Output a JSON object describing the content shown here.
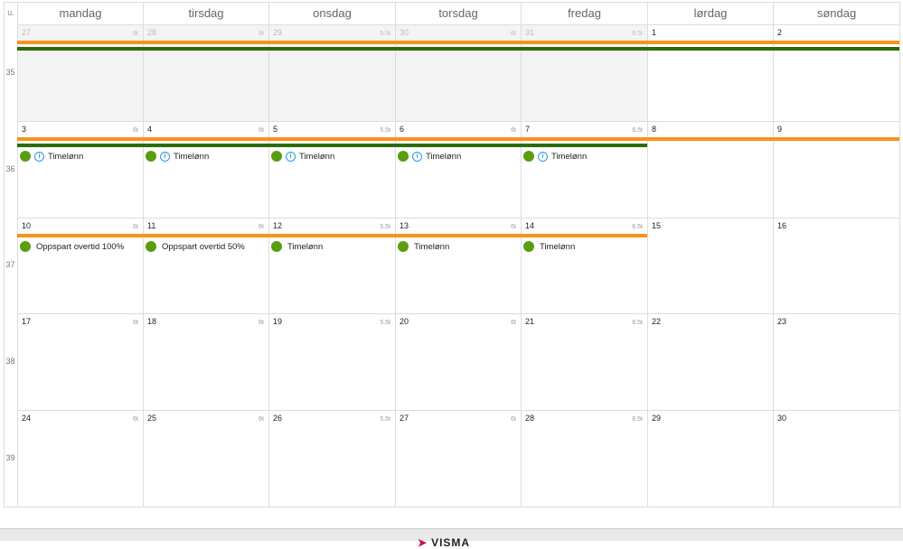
{
  "week_header": "u.",
  "days": [
    "mandag",
    "tirsdag",
    "onsdag",
    "torsdag",
    "fredag",
    "lørdag",
    "søndag"
  ],
  "weeks": [
    {
      "num": "35",
      "dates": [
        "27",
        "28",
        "29",
        "30",
        "31",
        "1",
        "2"
      ],
      "other": [
        true,
        true,
        true,
        true,
        true,
        false,
        false
      ],
      "hours": [
        "6t",
        "6t",
        "5.5t",
        "6t",
        "6.5t",
        "",
        ""
      ],
      "bars": [
        {
          "color": "#f7931e",
          "from": 0,
          "to": 7
        },
        {
          "color": "#2e6b0a",
          "from": 0,
          "to": 7
        }
      ],
      "events": []
    },
    {
      "num": "36",
      "dates": [
        "3",
        "4",
        "5",
        "6",
        "7",
        "8",
        "9"
      ],
      "other": [
        false,
        false,
        false,
        false,
        false,
        false,
        false
      ],
      "hours": [
        "6t",
        "6t",
        "5.5t",
        "6t",
        "6.5t",
        "",
        ""
      ],
      "bars": [
        {
          "color": "#f7931e",
          "from": 0,
          "to": 7
        },
        {
          "color": "#2e6b0a",
          "from": 0,
          "to": 5
        }
      ],
      "events": [
        {
          "day": 0,
          "label": "Timelønn",
          "info": true
        },
        {
          "day": 1,
          "label": "Timelønn",
          "info": true
        },
        {
          "day": 2,
          "label": "Timelønn",
          "info": true
        },
        {
          "day": 3,
          "label": "Timelønn",
          "info": true
        },
        {
          "day": 4,
          "label": "Timelønn",
          "info": true
        }
      ]
    },
    {
      "num": "37",
      "dates": [
        "10",
        "11",
        "12",
        "13",
        "14",
        "15",
        "16"
      ],
      "other": [
        false,
        false,
        false,
        false,
        false,
        false,
        false
      ],
      "hours": [
        "6t",
        "6t",
        "5.5t",
        "6t",
        "6.5t",
        "",
        ""
      ],
      "bars": [
        {
          "color": "#f7931e",
          "from": 0,
          "to": 5
        }
      ],
      "events": [
        {
          "day": 0,
          "label": "Oppspart overtid 100%",
          "info": false
        },
        {
          "day": 1,
          "label": "Oppspart overtid 50%",
          "info": false
        },
        {
          "day": 2,
          "label": "Timelønn",
          "info": false
        },
        {
          "day": 3,
          "label": "Timelønn",
          "info": false
        },
        {
          "day": 4,
          "label": "Timelønn",
          "info": false
        }
      ]
    },
    {
      "num": "38",
      "dates": [
        "17",
        "18",
        "19",
        "20",
        "21",
        "22",
        "23"
      ],
      "other": [
        false,
        false,
        false,
        false,
        false,
        false,
        false
      ],
      "hours": [
        "6t",
        "6t",
        "5.5t",
        "6t",
        "6.5t",
        "",
        ""
      ],
      "bars": [],
      "events": []
    },
    {
      "num": "39",
      "dates": [
        "24",
        "25",
        "26",
        "27",
        "28",
        "29",
        "30"
      ],
      "other": [
        false,
        false,
        false,
        false,
        false,
        false,
        false
      ],
      "hours": [
        "6t",
        "6t",
        "5.5t",
        "6t",
        "6.5t",
        "",
        ""
      ],
      "bars": [],
      "events": []
    }
  ],
  "footer": {
    "logo": "VISMA"
  }
}
